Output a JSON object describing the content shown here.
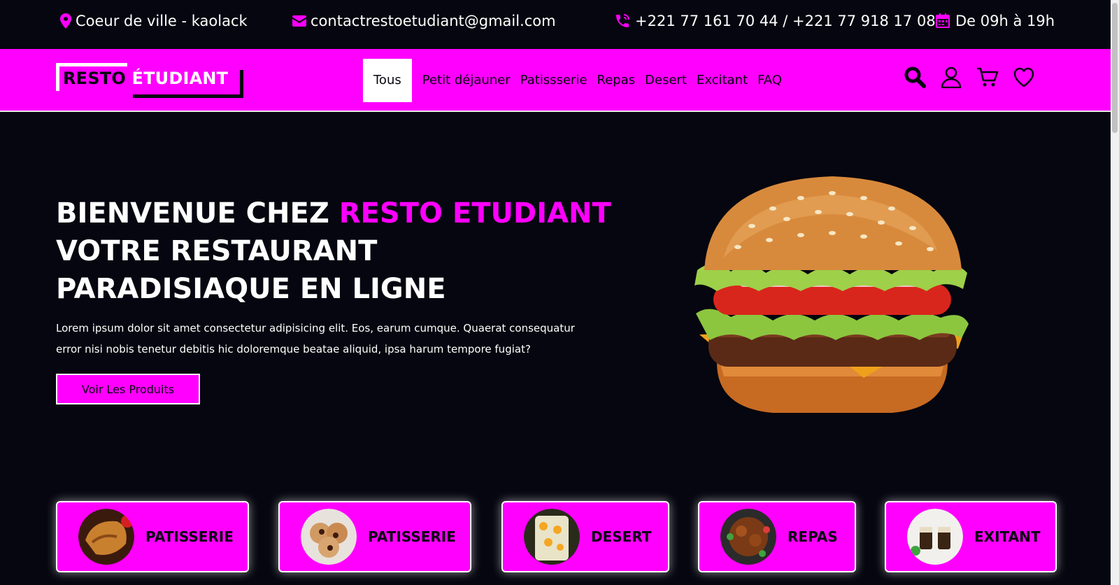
{
  "topbar": {
    "location": "Coeur de ville - kaolack",
    "email": "contactrestoetudiant@gmail.com",
    "phone": "+221 77 161 70 44 / +221 77 918 17 08",
    "hours": "De 09h à 19h",
    "icons": [
      "location-pin-icon",
      "envelope-icon",
      "phone-icon",
      "calendar-icon"
    ]
  },
  "logo": {
    "part1": "RESTO",
    "part2": "ÉTUDIANT"
  },
  "menu": {
    "items": [
      "Tous",
      "Petit déjauner",
      "Patissserie",
      "Repas",
      "Desert",
      "Excitant",
      "FAQ"
    ],
    "active": "Tous"
  },
  "nav_icons": [
    "search-icon",
    "user-icon",
    "cart-icon",
    "heart-icon"
  ],
  "hero": {
    "title_part1": "BIENVENUE CHEZ ",
    "title_highlight": "RESTO ETUDIANT",
    "title_part2": " VOTRE RESTAURANT PARADISIAQUE EN LIGNE",
    "description": "Lorem ipsum dolor sit amet consectetur adipisicing elit. Eos, earum cumque. Quaerat consequatur error nisi nobis tenetur debitis hic doloremque beatae aliquid, ipsa harum tempore fugiat?",
    "button": "Voir Les Produits"
  },
  "categories": [
    {
      "label": "PATISSERIE"
    },
    {
      "label": "PATISSERIE"
    },
    {
      "label": "DESERT"
    },
    {
      "label": "REPAS"
    },
    {
      "label": "EXITANT"
    }
  ],
  "colors": {
    "accent": "#ff00ff",
    "background": "#05060f",
    "white": "#ffffff"
  }
}
